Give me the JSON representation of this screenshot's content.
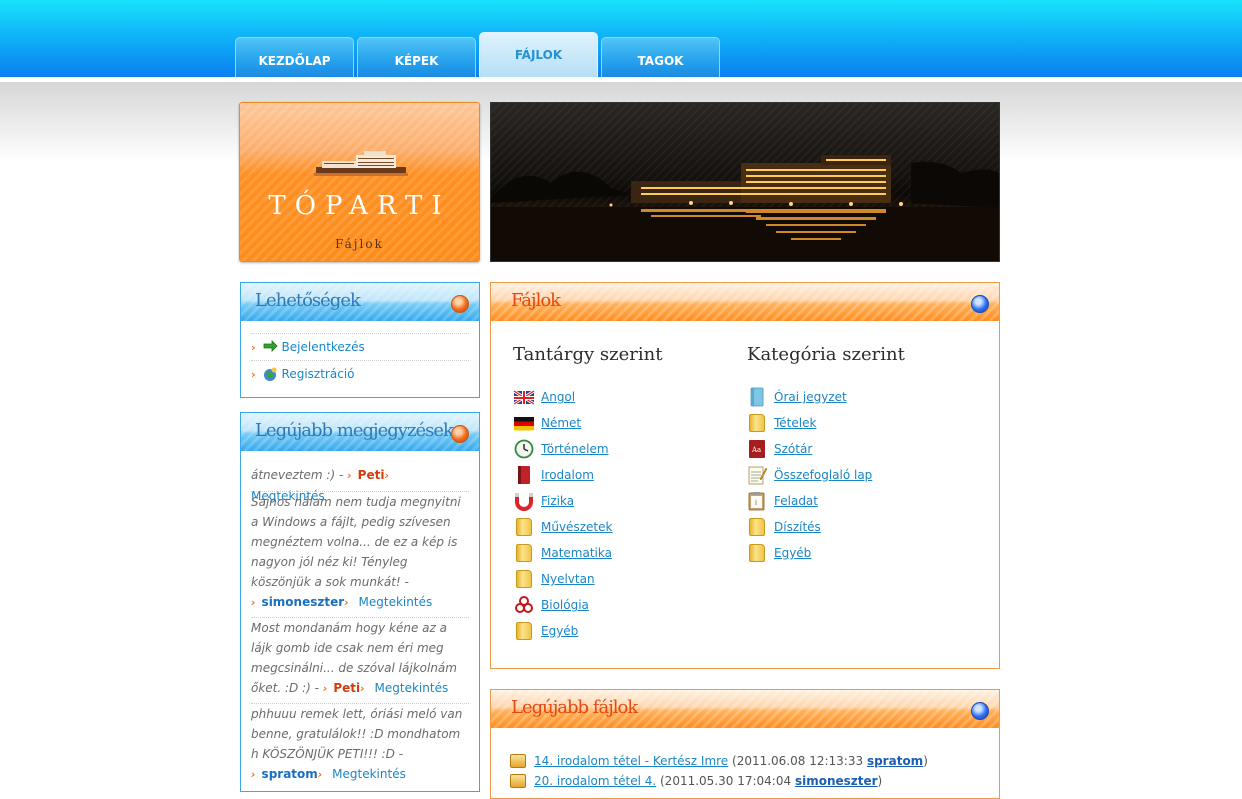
{
  "nav": {
    "tabs": [
      {
        "label": "KEZDŐLAP"
      },
      {
        "label": "KÉPEK"
      },
      {
        "label": "FÁJLOK"
      },
      {
        "label": "TAGOK"
      }
    ],
    "active_tab": "FÁJLOK"
  },
  "logo": {
    "title": "TÓPARTI",
    "subtitle": "Fájlok"
  },
  "sidebar": {
    "options": {
      "title": "Lehetőségek",
      "items": [
        {
          "label": "Bejelentkezés",
          "icon": "login-arrow-icon"
        },
        {
          "label": "Regisztráció",
          "icon": "register-globe-icon"
        }
      ]
    },
    "comments": {
      "title": "Legújabb megjegyzések",
      "items": [
        {
          "text": "átneveztem :) -",
          "author": "Peti",
          "more": "Megtekintés"
        },
        {
          "text": "Sajnos nálam nem tudja megnyitni a Windows a fájlt, pedig szívesen megnéztem volna... de ez a kép is nagyon jól néz ki! Tényleg köszönjük a sok munkát! -",
          "author": "simoneszter",
          "more": "Megtekintés"
        },
        {
          "text": "Most mondanám hogy kéne az a lájk gomb ide csak nem éri meg megcsinálni... de szóval lájkolnám őket. :D :) -",
          "author": "Peti",
          "more": "Megtekintés"
        },
        {
          "text": "phhuuu remek lett, óriási meló van benne, gratulálok!! :D mondhatom h KÖSZÖNJÜK PETI!!! :D -",
          "author": "spratom",
          "more": "Megtekintés"
        }
      ]
    }
  },
  "files": {
    "title": "Fájlok",
    "by_subject": {
      "heading": "Tantárgy szerint",
      "items": [
        {
          "label": "Angol",
          "icon": "uk-flag-icon"
        },
        {
          "label": "Német",
          "icon": "german-flag-icon"
        },
        {
          "label": "Történelem",
          "icon": "clock-icon"
        },
        {
          "label": "Irodalom",
          "icon": "book-icon"
        },
        {
          "label": "Fizika",
          "icon": "magnet-icon"
        },
        {
          "label": "Művészetek",
          "icon": "folder-icon"
        },
        {
          "label": "Matematika",
          "icon": "folder-icon"
        },
        {
          "label": "Nyelvtan",
          "icon": "folder-icon"
        },
        {
          "label": "Biológia",
          "icon": "biohazard-icon"
        },
        {
          "label": "Egyéb",
          "icon": "folder-icon"
        }
      ]
    },
    "by_category": {
      "heading": "Kategória szerint",
      "items": [
        {
          "label": "Órai jegyzet",
          "icon": "notebook-icon"
        },
        {
          "label": "Tételek",
          "icon": "folder-icon"
        },
        {
          "label": "Szótár",
          "icon": "dictionary-icon"
        },
        {
          "label": "Összefoglaló lap",
          "icon": "notepad-icon"
        },
        {
          "label": "Feladat",
          "icon": "clipboard-icon"
        },
        {
          "label": "Díszítés",
          "icon": "folder-icon"
        },
        {
          "label": "Egyéb",
          "icon": "folder-icon"
        }
      ]
    }
  },
  "recent_files": {
    "title": "Legújabb fájlok",
    "items": [
      {
        "name": "14. irodalom tétel - Kertész Imre",
        "date": "(2011.06.08 12:13:33",
        "user": "spratom",
        "close": ")"
      },
      {
        "name": "20. irodalom tétel 4.",
        "date": "(2011.05.30 17:04:04",
        "user": "simoneszter",
        "close": ")"
      }
    ]
  },
  "colors": {
    "accent_blue": "#1b86c6",
    "accent_orange": "#f26d1b"
  }
}
